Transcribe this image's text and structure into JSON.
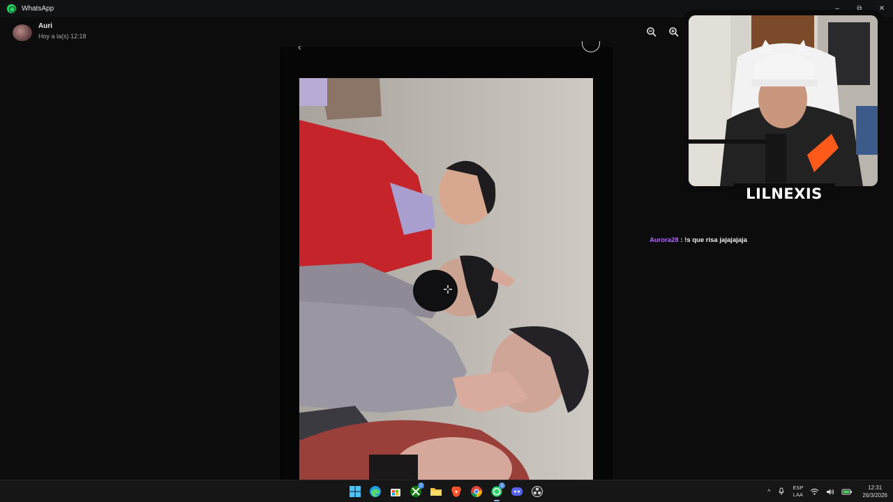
{
  "app": {
    "title": "WhatsApp",
    "icon": "whatsapp-icon",
    "brand_color": "#25d366"
  },
  "window_controls": {
    "minimize": "–",
    "restore": "⧉",
    "close": "✕"
  },
  "chat_header": {
    "contact_name": "Auri",
    "last_seen": "Hoy a la(s) 12:18",
    "zoom_out_icon": "zoom-out-icon",
    "zoom_in_icon": "zoom-in-icon"
  },
  "media_viewer": {
    "back_icon": "back-arrow-icon",
    "image": "photo of five people posing indoors (rotated)"
  },
  "stream_overlay": {
    "webcam_label": "LILNEXIS",
    "chat": {
      "user": "Aurora28",
      "separator": " : ",
      "message": "!s que risa jajajajaja",
      "user_color": "#b366ff"
    }
  },
  "taskbar": {
    "apps": [
      {
        "name": "start-button",
        "icon": "windows-icon"
      },
      {
        "name": "edge",
        "icon": "edge-icon"
      },
      {
        "name": "store",
        "icon": "store-icon"
      },
      {
        "name": "xbox",
        "icon": "xbox-icon",
        "badge": "7"
      },
      {
        "name": "file-explorer",
        "icon": "folder-icon"
      },
      {
        "name": "brave",
        "icon": "brave-icon"
      },
      {
        "name": "chrome",
        "icon": "chrome-icon"
      },
      {
        "name": "whatsapp",
        "icon": "whatsapp-icon",
        "badge": "2",
        "active": true
      },
      {
        "name": "discord",
        "icon": "discord-icon"
      },
      {
        "name": "obs",
        "icon": "obs-icon"
      }
    ],
    "tray": {
      "chevron": "^",
      "lang_top": "ESP",
      "lang_bottom": "LAA",
      "time": "12:31",
      "date": "26/3/2026"
    }
  }
}
